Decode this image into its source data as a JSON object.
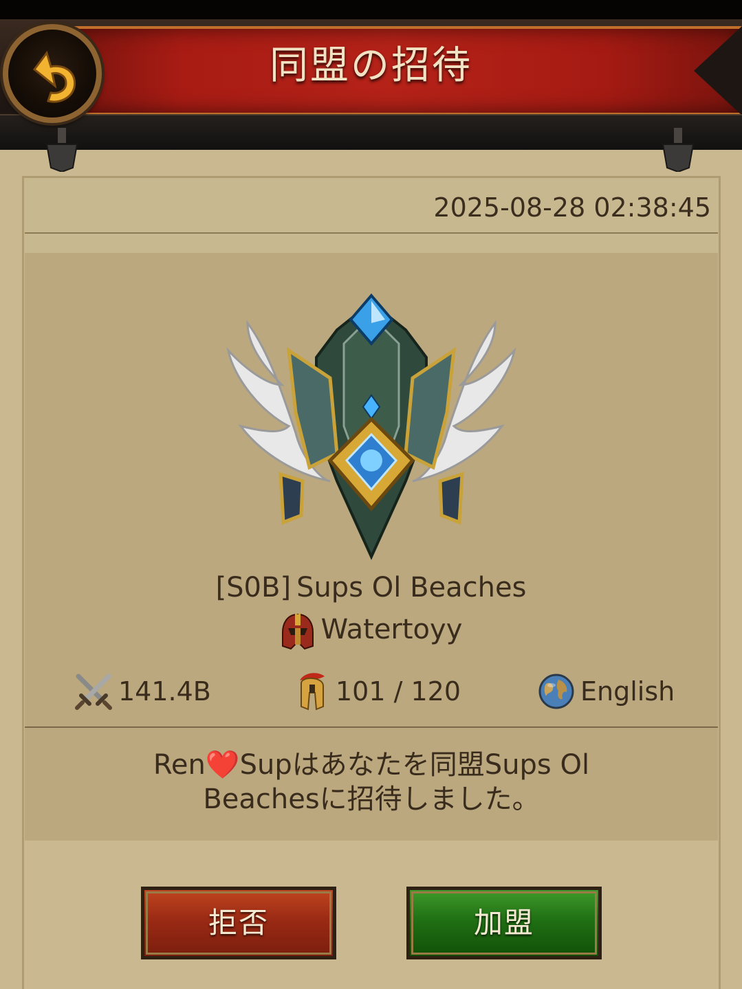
{
  "header": {
    "title": "同盟の招待",
    "back_icon": "back-arrow-icon"
  },
  "invite": {
    "timestamp": "2025-08-28 02:38:45",
    "alliance_tag": "[S0B]",
    "alliance_name": "Sups Ol Beaches",
    "leader_name": "Watertoyy",
    "power": "141.4B",
    "members": "101 / 120",
    "language": "English",
    "message_line1": "Ren❤️Supはあなたを同盟Sups Ol",
    "message_line2": "Beachesに招待しました。"
  },
  "actions": {
    "reject_label": "拒否",
    "join_label": "加盟"
  },
  "colors": {
    "banner_red": "#b52218",
    "reject_red": "#9a2a14",
    "join_green": "#207014",
    "parchment": "#c9b890"
  }
}
